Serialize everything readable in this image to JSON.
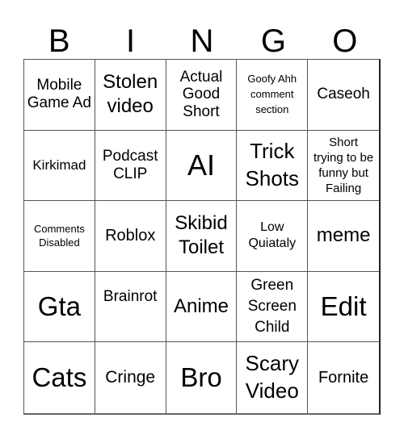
{
  "header": {
    "letters": [
      "B",
      "I",
      "N",
      "G",
      "O"
    ]
  },
  "board": {
    "rows": [
      [
        "Mobile Game Ad",
        "Stolen video",
        "Actual Good Short",
        "Goofy Ahh comment section",
        "Caseoh"
      ],
      [
        "Kirkimad",
        "Podcast CLIP",
        "AI",
        "Trick Shots",
        "Short trying to be funny but Failing"
      ],
      [
        "Comments Disabled",
        "Roblox",
        "Skibid Toilet",
        "Low Quiataly",
        "meme"
      ],
      [
        "Gta",
        "Brainrot",
        "Anime",
        "Green Screen Child",
        "Edit"
      ],
      [
        "Cats",
        "Cringe",
        "Bro",
        "Scary Video",
        "Fornite"
      ]
    ]
  }
}
